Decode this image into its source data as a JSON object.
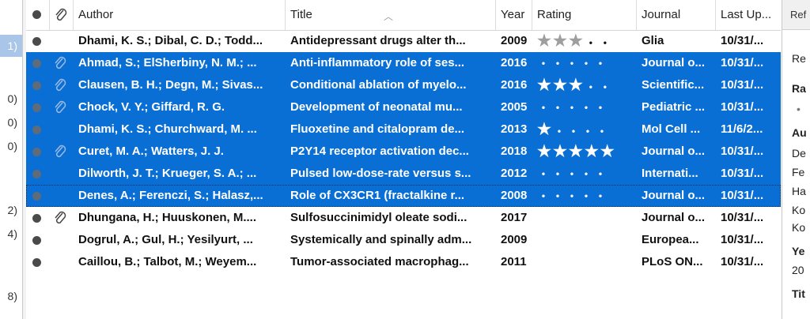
{
  "left_strip": {
    "counts": [
      "1)",
      "0)",
      "0)",
      "0)",
      "2)",
      "4)",
      "8)"
    ]
  },
  "columns": {
    "author": "Author",
    "title": "Title",
    "year": "Year",
    "rating": "Rating",
    "journal": "Journal",
    "last_updated": "Last Up..."
  },
  "rows": [
    {
      "author": "Dhami, K. S.; Dibal, C. D.; Todd...",
      "title": "Antidepressant drugs alter th...",
      "year": "2009",
      "rating": 3,
      "journal": "Glia",
      "updated": "10/31/...",
      "attachment": false,
      "selected": false
    },
    {
      "author": "Ahmad, S.; ElSherbiny, N. M.; ...",
      "title": "Anti-inflammatory role of ses...",
      "year": "2016",
      "rating": 0,
      "journal": "Journal o...",
      "updated": "10/31/...",
      "attachment": true,
      "selected": true
    },
    {
      "author": "Clausen, B. H.; Degn, M.; Sivas...",
      "title": "Conditional ablation of myelo...",
      "year": "2016",
      "rating": 3,
      "journal": "Scientific...",
      "updated": "10/31/...",
      "attachment": true,
      "selected": true
    },
    {
      "author": "Chock, V. Y.; Giffard, R. G.",
      "title": "Development of neonatal mu...",
      "year": "2005",
      "rating": 0,
      "journal": "Pediatric ...",
      "updated": "10/31/...",
      "attachment": true,
      "selected": true
    },
    {
      "author": "Dhami, K. S.; Churchward, M. ...",
      "title": "Fluoxetine and citalopram de...",
      "year": "2013",
      "rating": 1,
      "journal": "Mol Cell ...",
      "updated": "11/6/2...",
      "attachment": false,
      "selected": true
    },
    {
      "author": "Curet, M. A.; Watters, J. J.",
      "title": "P2Y14 receptor activation dec...",
      "year": "2018",
      "rating": 5,
      "journal": "Journal o...",
      "updated": "10/31/...",
      "attachment": true,
      "selected": true
    },
    {
      "author": "Dilworth, J. T.; Krueger, S. A.; ...",
      "title": "Pulsed low-dose-rate versus s...",
      "year": "2012",
      "rating": 0,
      "journal": "Internati...",
      "updated": "10/31/...",
      "attachment": false,
      "selected": true
    },
    {
      "author": "Denes, A.; Ferenczi, S.; Halasz,...",
      "title": "Role of CX3CR1 (fractalkine r...",
      "year": "2008",
      "rating": 0,
      "journal": "Journal o...",
      "updated": "10/31/...",
      "attachment": false,
      "selected": true
    },
    {
      "author": "Dhungana, H.; Huuskonen, M....",
      "title": "Sulfosuccinimidyl oleate sodi...",
      "year": "2017",
      "rating": null,
      "journal": "Journal o...",
      "updated": "10/31/...",
      "attachment": true,
      "selected": false
    },
    {
      "author": "Dogrul, A.; Gul, H.; Yesilyurt, ...",
      "title": "Systemically and spinally adm...",
      "year": "2009",
      "rating": null,
      "journal": "Europea...",
      "updated": "10/31/...",
      "attachment": false,
      "selected": false
    },
    {
      "author": "Caillou, B.; Talbot, M.; Weyem...",
      "title": "Tumor-associated macrophag...",
      "year": "2011",
      "rating": null,
      "journal": "PLoS ON...",
      "updated": "10/31/...",
      "attachment": false,
      "selected": false
    }
  ],
  "right_pane": {
    "tab": "Ref",
    "lines": [
      "Re",
      "Ra",
      "•",
      "Au",
      "De",
      "Fe",
      "Ha",
      "Ko",
      "Ko",
      "Ye",
      "20",
      "Tit"
    ]
  },
  "colors": {
    "selection": "#0a6fd4",
    "star_gray": "#9e9e9e"
  }
}
